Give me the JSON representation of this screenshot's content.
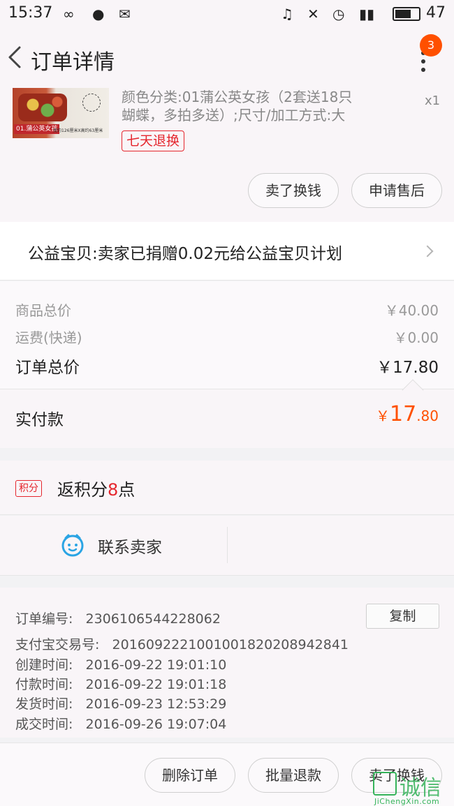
{
  "status_bar": {
    "time": "15:37",
    "battery": "47"
  },
  "header": {
    "title": "订单详情",
    "badge_count": "3"
  },
  "product": {
    "thumb_label": "01.蒲公英女孩",
    "thumb_sub": "宽约126厘米X高约63厘米",
    "sku_line1": "颜色分类:01蒲公英女孩（2套送18只",
    "sku_line2": "蝴蝶，多拍多送）;尺寸/加工方式:大",
    "quantity": "x1",
    "tag": "七天退换",
    "buttons": {
      "sell": "卖了换钱",
      "after_sale": "申请售后"
    }
  },
  "charity": {
    "text": "公益宝贝:卖家已捐赠0.02元给公益宝贝计划"
  },
  "prices": {
    "goods_label": "商品总价",
    "goods_value": "￥40.00",
    "shipping_label": "运费(快递)",
    "shipping_value": "￥0.00",
    "total_label": "订单总价",
    "total_value": "￥17.80"
  },
  "paid": {
    "label": "实付款",
    "currency": "￥",
    "integer": "17",
    "decimal": ".80"
  },
  "points": {
    "badge": "积分",
    "text_prefix": "返积分",
    "number": "8",
    "text_suffix": "点"
  },
  "contact": {
    "label": "联系卖家"
  },
  "order_info": {
    "order_no_label": "订单编号:",
    "order_no": "2306106544228062",
    "alipay_label": "支付宝交易号:",
    "alipay_no": "2016092221001001820208942841",
    "created_label": "创建时间:",
    "created": "2016-09-22 19:01:10",
    "paid_label": "付款时间:",
    "paid_time": "2016-09-22 19:01:18",
    "shipped_label": "发货时间:",
    "shipped": "2016-09-23 12:53:29",
    "closed_label": "成交时间:",
    "closed": "2016-09-26 19:07:04",
    "copy_button": "复制"
  },
  "footer": {
    "delete": "删除订单",
    "batch_refund": "批量退款",
    "sell": "卖了换钱"
  },
  "watermark": {
    "url": "JiChengXin.com"
  },
  "colors": {
    "accent": "#ff5000",
    "red": "#e5262d",
    "chat_blue": "#2aa4e4",
    "watermark_green": "#35b35a"
  }
}
